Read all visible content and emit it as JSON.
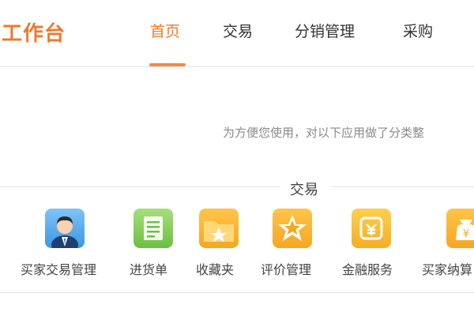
{
  "header": {
    "brand": "工作台",
    "tabs": [
      {
        "label": "首页",
        "active": true
      },
      {
        "label": "交易",
        "active": false
      },
      {
        "label": "分销管理",
        "active": false
      },
      {
        "label": "采购",
        "active": false
      }
    ]
  },
  "hint": "为方便您使用，对以下应用做了分类整",
  "section": {
    "title": "交易",
    "apps": [
      {
        "label": "买家交易管理",
        "icon": "buyer-avatar-icon"
      },
      {
        "label": "进货单",
        "icon": "purchase-list-icon"
      },
      {
        "label": "收藏夹",
        "icon": "favorites-folder-icon"
      },
      {
        "label": "评价管理",
        "icon": "rating-star-icon"
      },
      {
        "label": "金融服务",
        "icon": "finance-icon"
      },
      {
        "label": "买家纳算",
        "icon": "payment-bag-icon"
      }
    ]
  },
  "colors": {
    "accent": "#f0782b",
    "divider": "#e3e3e3",
    "hint_text": "#8a8a8a"
  }
}
